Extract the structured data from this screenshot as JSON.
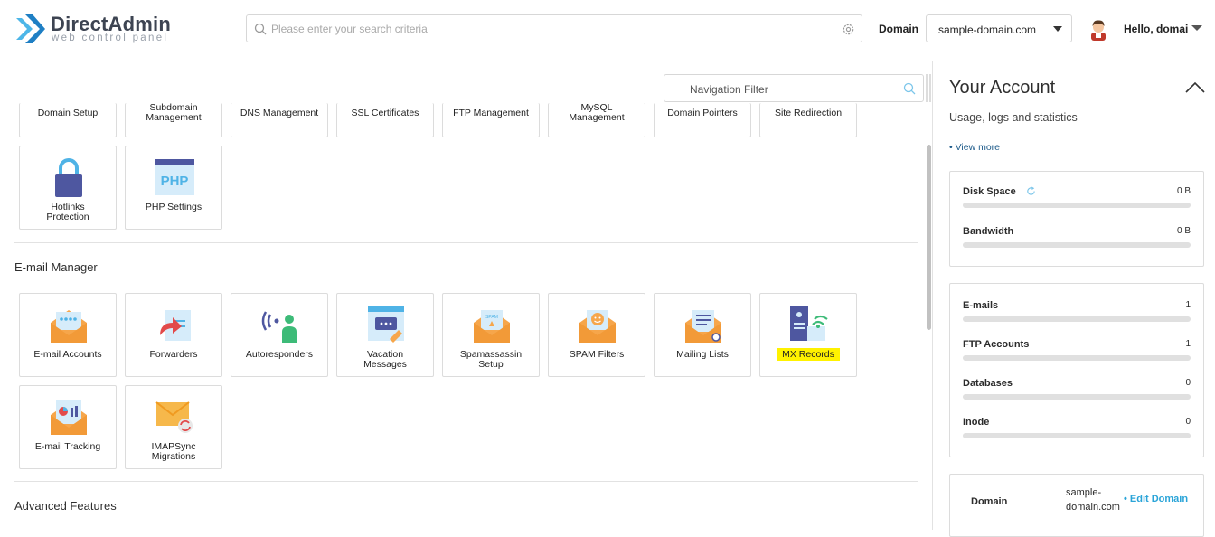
{
  "brand": {
    "title": "DirectAdmin",
    "subtitle": "web control panel"
  },
  "header": {
    "search_placeholder": "Please enter your search criteria",
    "domain_label": "Domain",
    "domain_value": "sample-domain.com",
    "greeting": "Hello, domai"
  },
  "main": {
    "nav_filter_placeholder": "Navigation Filter",
    "account_tiles": [
      "Domain Setup",
      "Subdomain Management",
      "DNS Management",
      "SSL Certificates",
      "FTP Management",
      "MySQL Management",
      "Domain Pointers",
      "Site Redirection"
    ],
    "account_tiles_row2": [
      "Hotlinks Protection",
      "PHP Settings"
    ],
    "email_section_title": "E-mail Manager",
    "email_tiles": [
      "E-mail Accounts",
      "Forwarders",
      "Autoresponders",
      "Vacation Messages",
      "Spamassassin Setup",
      "SPAM Filters",
      "Mailing Lists",
      "MX Records"
    ],
    "email_tiles_row2": [
      "E-mail Tracking",
      "IMAPSync Migrations"
    ],
    "advanced_section_title": "Advanced Features"
  },
  "panel": {
    "title": "Your Account",
    "subtitle": "Usage, logs and statistics",
    "view_more": "• View more",
    "usage": [
      {
        "name": "Disk Space",
        "value": "0 B"
      },
      {
        "name": "Bandwidth",
        "value": "0 B"
      }
    ],
    "counts": [
      {
        "name": "E-mails",
        "value": "1"
      },
      {
        "name": "FTP Accounts",
        "value": "1"
      },
      {
        "name": "Databases",
        "value": "0"
      },
      {
        "name": "Inode",
        "value": "0"
      }
    ],
    "domain_label": "Domain",
    "domain_value": "sample-domain.com",
    "edit_domain": "• Edit Domain"
  },
  "colors": {
    "accent": "#2aa4d8",
    "highlight": "#fff200",
    "brand_blue": "#1f8ed1"
  }
}
